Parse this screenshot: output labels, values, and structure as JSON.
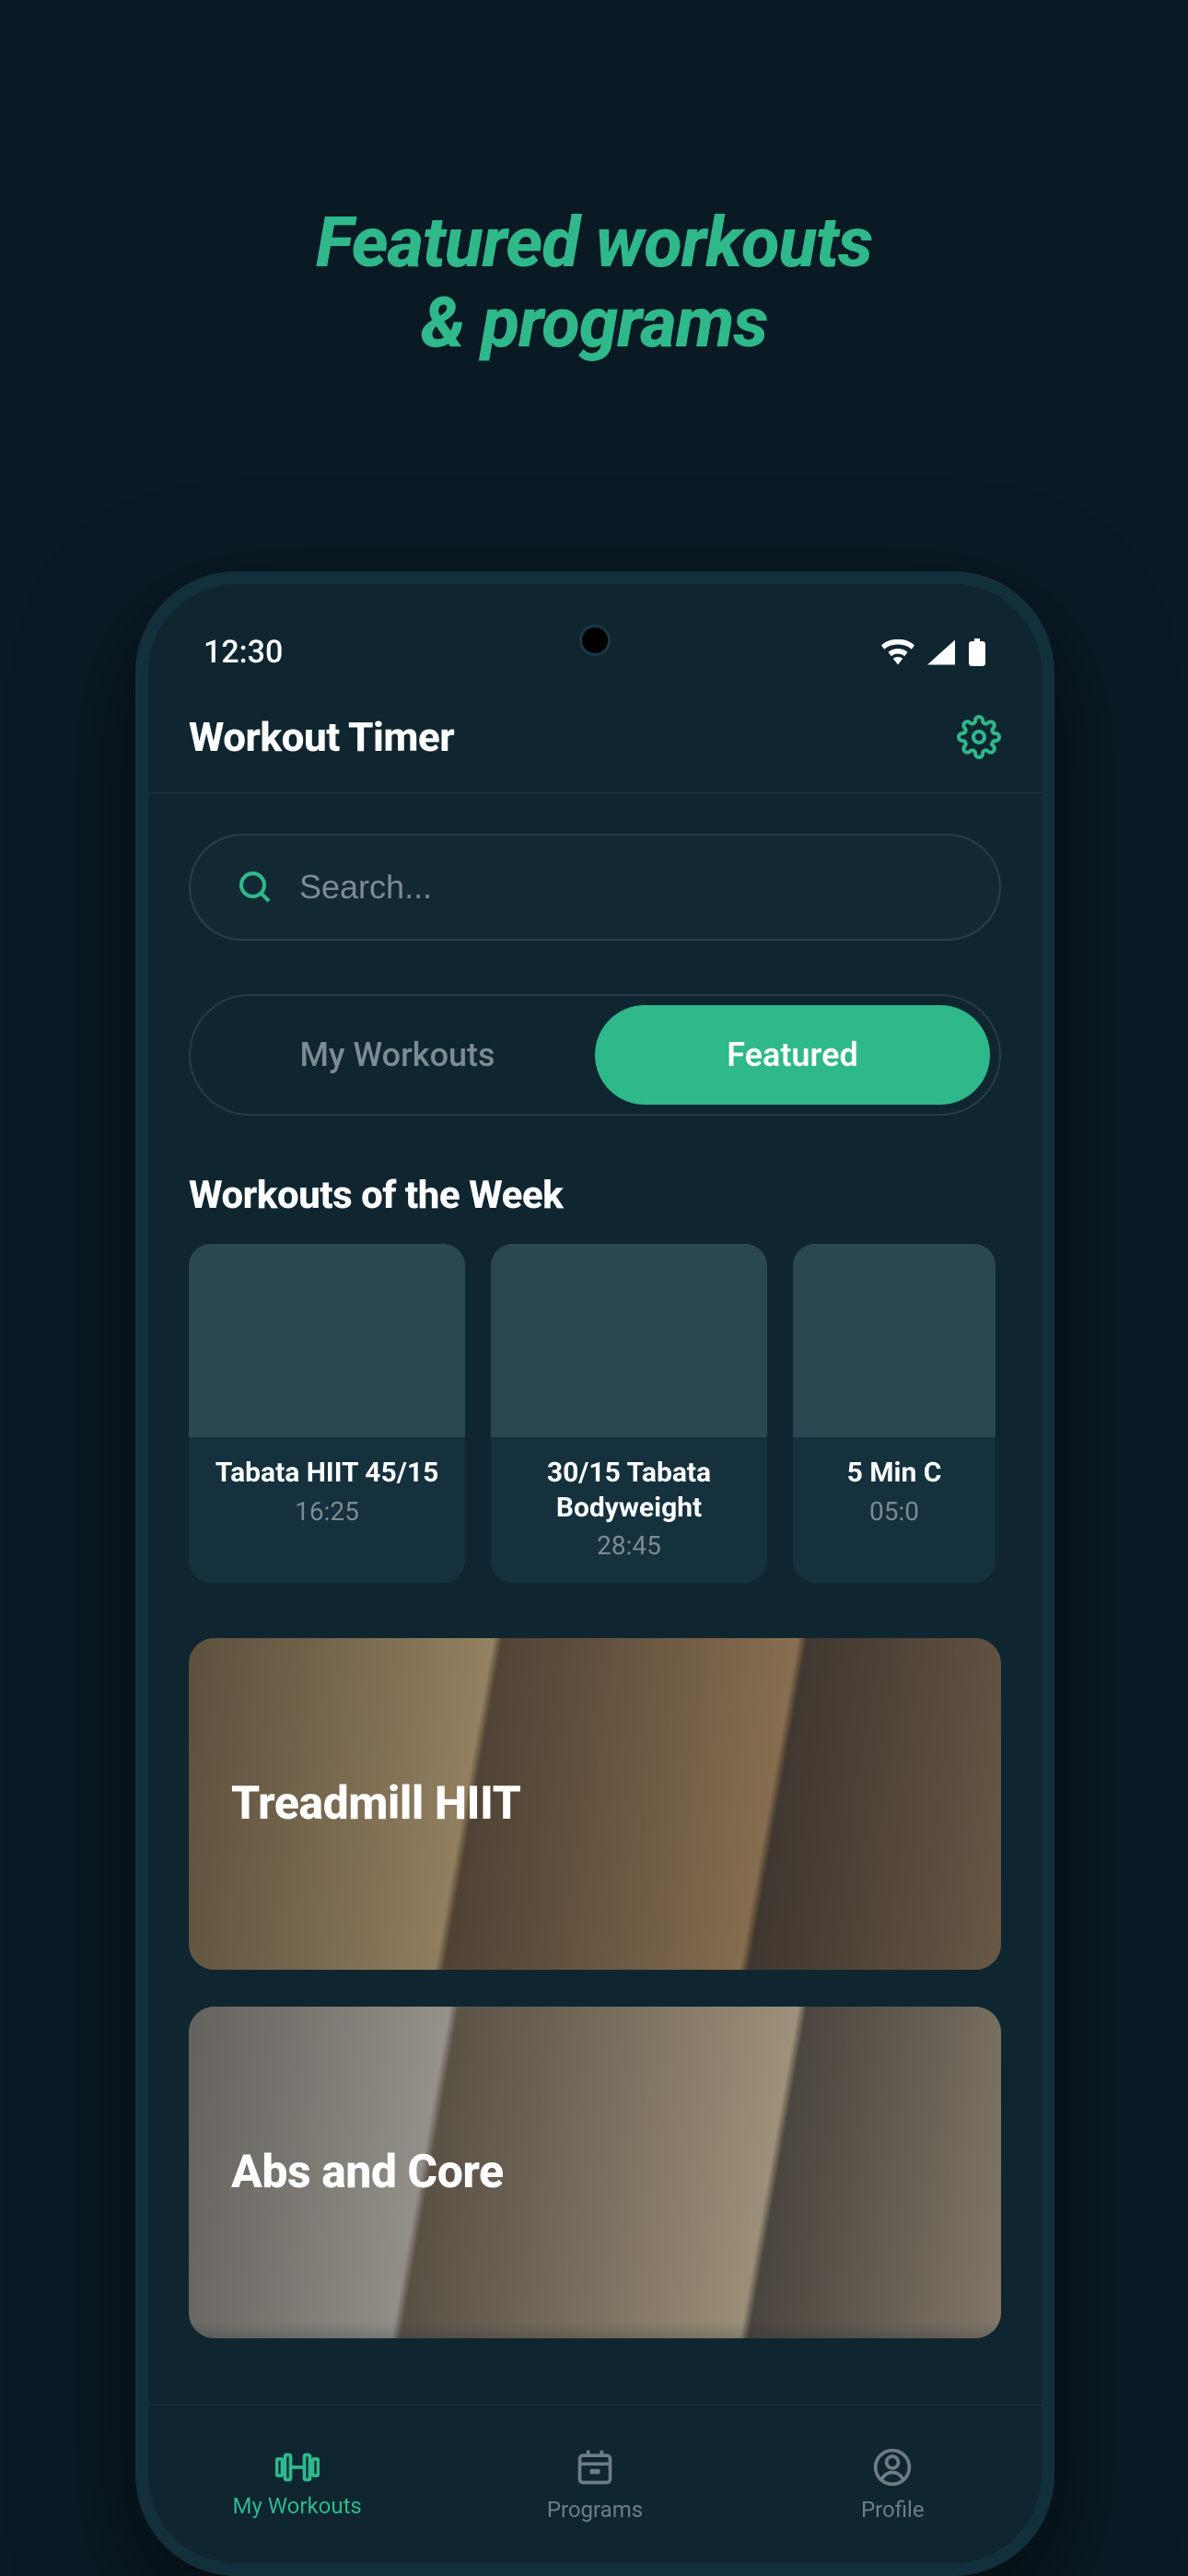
{
  "promo": {
    "line1": "Featured workouts",
    "line2": "& programs"
  },
  "status": {
    "time": "12:30"
  },
  "header": {
    "title": "Workout Timer"
  },
  "search": {
    "placeholder": "Search..."
  },
  "filter": {
    "my": "My Workouts",
    "featured": "Featured"
  },
  "section_week": "Workouts of the Week",
  "week_cards": [
    {
      "title": "Tabata HIIT 45/15",
      "duration": "16:25"
    },
    {
      "title": "30/15 Tabata Bodyweight",
      "duration": "28:45"
    },
    {
      "title": "5 Min C",
      "duration": "05:0"
    }
  ],
  "programs": [
    {
      "title": "Treadmill HIIT"
    },
    {
      "title": "Abs and Core"
    }
  ],
  "nav": {
    "workouts": "My Workouts",
    "programs": "Programs",
    "profile": "Profile"
  },
  "colors": {
    "accent": "#2fb88a",
    "bg": "#0f2631"
  }
}
